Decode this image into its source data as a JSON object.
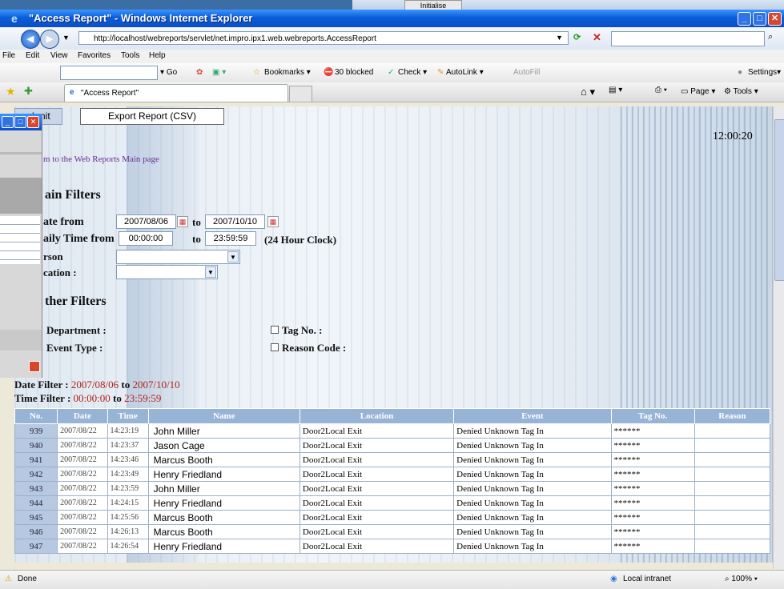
{
  "background_window": {
    "button_label": "Initialise"
  },
  "window": {
    "title": "\"Access Report\" - Windows Internet Explorer"
  },
  "address": {
    "url": "http://localhost/webreports/servlet/net.impro.ipx1.web.webreports.AccessReport"
  },
  "menu": [
    "File",
    "Edit",
    "View",
    "Favorites",
    "Tools",
    "Help"
  ],
  "toolbar": {
    "go": "Go",
    "bookmarks": "Bookmarks",
    "blocked": "30 blocked",
    "check": "Check",
    "autolink": "AutoLink",
    "autofill": "AutoFill",
    "settings": "Settings"
  },
  "tabs": {
    "active": "\"Access Report\"",
    "page": "Page",
    "tools": "Tools"
  },
  "report": {
    "submit_label": "ubmit",
    "export_label": "Export Report (CSV)",
    "clock": "12:00:20",
    "main_link": "m to the Web Reports Main page",
    "main_filters": "ain Filters",
    "date_from_label": "ate from",
    "date_from": "2007/08/06",
    "to": "to",
    "date_to": "2007/10/10",
    "time_from_label": "aily Time from",
    "time_from": "00:00:00",
    "time_to": "23:59:59",
    "clock_note": "(24 Hour Clock)",
    "person_label": "rson",
    "location_label": "cation :",
    "other_filters": "ther Filters",
    "department_label": "Department :",
    "event_type_label": "Event Type :",
    "tag_label": "Tag No. :",
    "reason_label": "Reason Code :",
    "date_filter_label": "Date Filter :",
    "date_filter_from": "2007/08/06",
    "date_filter_to": "2007/10/10",
    "time_filter_label": "Time Filter :",
    "time_filter_from": "00:00:00",
    "time_filter_to": "23:59:59"
  },
  "table": {
    "headers": [
      "No.",
      "Date",
      "Time",
      "Name",
      "Location",
      "Event",
      "Tag No.",
      "Reason"
    ],
    "rows": [
      [
        "939",
        "2007/08/22",
        "14:23:19",
        "John  Miller",
        "Door2Local Exit",
        "Denied Unknown Tag In",
        "******",
        ""
      ],
      [
        "940",
        "2007/08/22",
        "14:23:37",
        "Jason  Cage",
        "Door2Local Exit",
        "Denied Unknown Tag In",
        "******",
        ""
      ],
      [
        "941",
        "2007/08/22",
        "14:23:46",
        "Marcus  Booth",
        "Door2Local Exit",
        "Denied Unknown Tag In",
        "******",
        ""
      ],
      [
        "942",
        "2007/08/22",
        "14:23:49",
        "Henry  Friedland",
        "Door2Local Exit",
        "Denied Unknown Tag In",
        "******",
        ""
      ],
      [
        "943",
        "2007/08/22",
        "14:23:59",
        "John  Miller",
        "Door2Local Exit",
        "Denied Unknown Tag In",
        "******",
        ""
      ],
      [
        "944",
        "2007/08/22",
        "14:24:15",
        "Henry  Friedland",
        "Door2Local Exit",
        "Denied Unknown Tag In",
        "******",
        ""
      ],
      [
        "945",
        "2007/08/22",
        "14:25:56",
        "Marcus  Booth",
        "Door2Local Exit",
        "Denied Unknown Tag In",
        "******",
        ""
      ],
      [
        "946",
        "2007/08/22",
        "14:26:13",
        "Marcus  Booth",
        "Door2Local Exit",
        "Denied Unknown Tag In",
        "******",
        ""
      ],
      [
        "947",
        "2007/08/22",
        "14:26:54",
        "Henry  Friedland",
        "Door2Local Exit",
        "Denied Unknown Tag In",
        "******",
        ""
      ]
    ]
  },
  "status": {
    "done": "Done",
    "zone": "Local intranet",
    "zoom": "100%"
  }
}
